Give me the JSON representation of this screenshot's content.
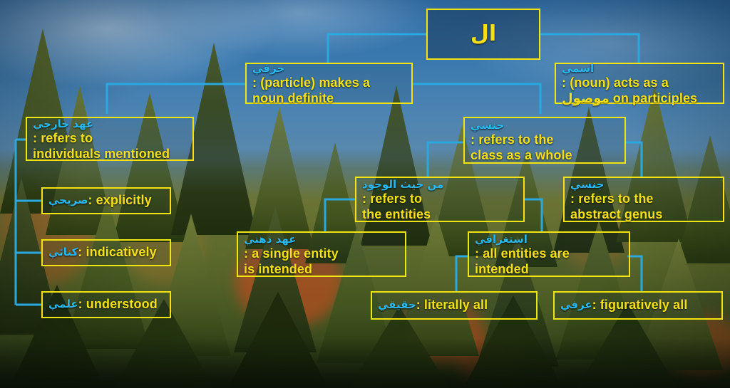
{
  "diagram": {
    "title_root": "ال",
    "colors": {
      "node_border": "#f2e413",
      "english_text": "#f5e017",
      "arabic_text": "#29b7ef",
      "connector": "#2aa8e0"
    },
    "nodes": [
      {
        "id": "root",
        "arabic": "",
        "english": "ال",
        "level": 0
      },
      {
        "id": "harfi",
        "arabic": "حرفي",
        "english": ": (particle) makes a noun definite",
        "english_line1": ": (particle) makes a",
        "english_line2": "noun definite",
        "level": 1
      },
      {
        "id": "ismi",
        "arabic": "اسمي",
        "english": ": (noun) acts as a موصول on participles",
        "english_line1": ": (noun) acts as a",
        "english_line2": "موصول on participles",
        "level": 1
      },
      {
        "id": "ahd-khariji",
        "arabic": "عهد خارجي",
        "english": ": refers to individuals mentioned",
        "english_line1": ": refers to",
        "english_line2": "individuals mentioned",
        "level": 2
      },
      {
        "id": "jinsi",
        "arabic": "جنسي",
        "english": ": refers to the class as a whole",
        "english_line1": ": refers to the",
        "english_line2": "class as a whole",
        "level": 2
      },
      {
        "id": "sarihi",
        "arabic": "صريحي",
        "english": ": explicitly",
        "level": 3
      },
      {
        "id": "kinai",
        "arabic": "كنائي",
        "english": ": indicatively",
        "level": 3
      },
      {
        "id": "ilmi",
        "arabic": "علمي",
        "english": ": understood",
        "level": 3
      },
      {
        "id": "min-hayth-al-wujud",
        "arabic": "من حيث الوجود",
        "english": ": refers to the entities",
        "english_line1": ": refers to",
        "english_line2": "the entities",
        "level": 3
      },
      {
        "id": "jinsi-abstract",
        "arabic": "جنسي",
        "english": ": refers to the abstract genus",
        "english_line1": ": refers to the",
        "english_line2": "abstract genus",
        "level": 3
      },
      {
        "id": "ahd-dhihni",
        "arabic": "عهد ذهني",
        "english": ": a single entity is intended",
        "english_line1": ": a single entity",
        "english_line2": "is intended",
        "level": 4
      },
      {
        "id": "istighraqi",
        "arabic": "استغراقي",
        "english": ": all entities are intended",
        "english_line1": ": all entities are",
        "english_line2": "intended",
        "level": 4
      },
      {
        "id": "haqiqi",
        "arabic": "حقيقي",
        "english": ": literally all",
        "level": 5
      },
      {
        "id": "urfi",
        "arabic": "عرفي",
        "english": ": figuratively all",
        "level": 5
      }
    ]
  }
}
